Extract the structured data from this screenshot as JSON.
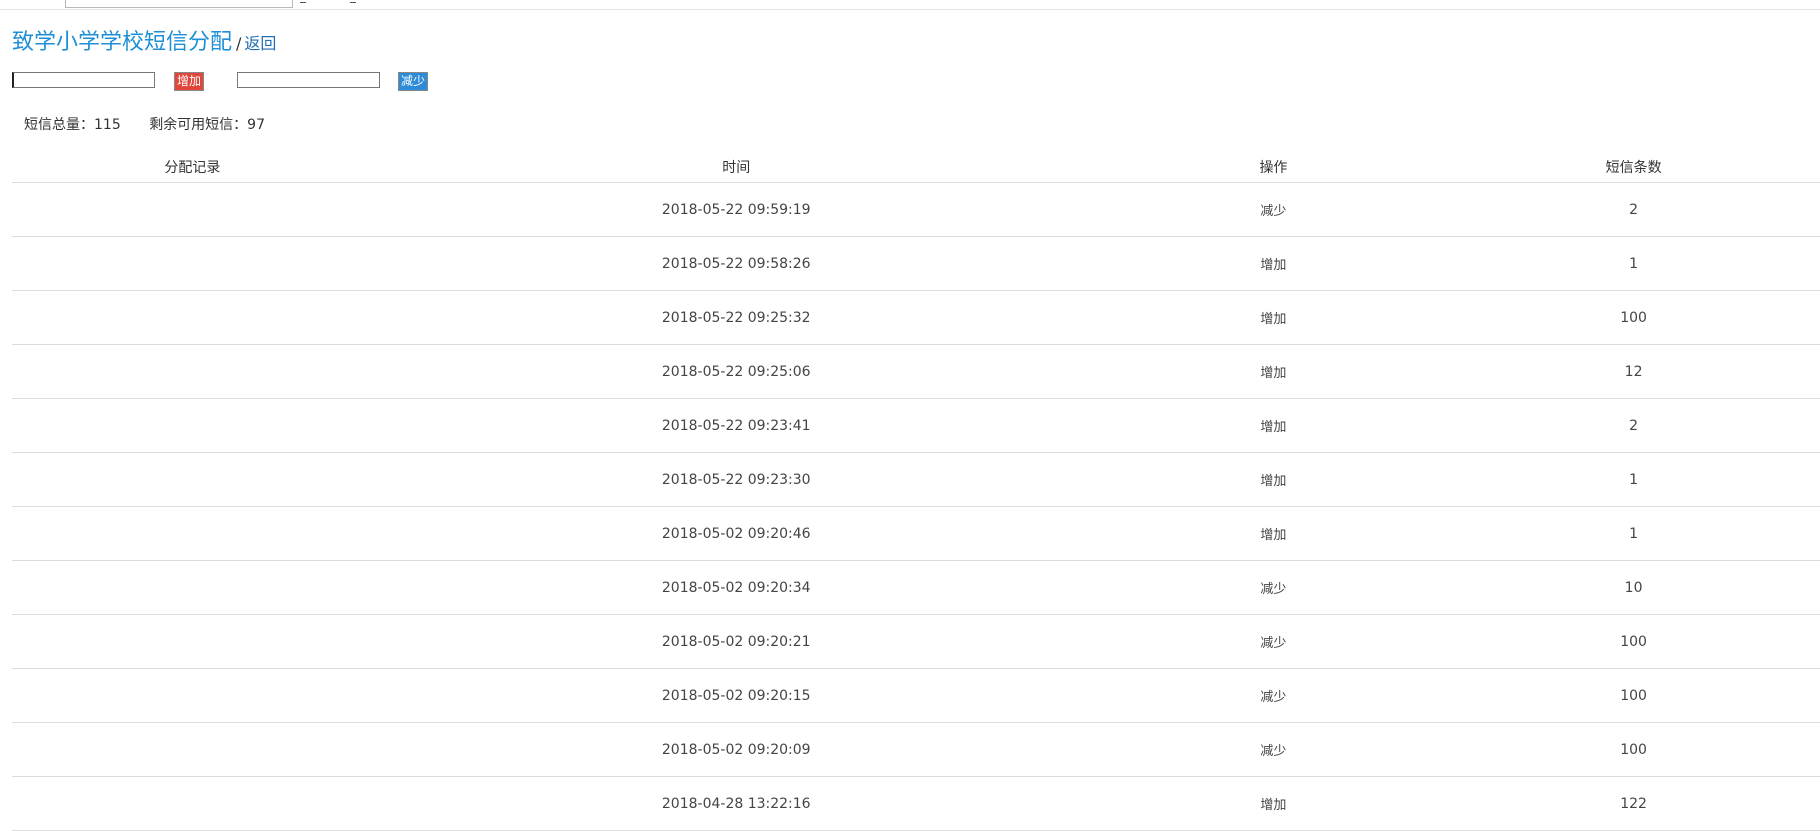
{
  "header": {
    "title": "致学小学学校短信分配",
    "separator": "/",
    "back_label": "返回"
  },
  "controls": {
    "add_label": "增加",
    "sub_label": "减少",
    "add_value": "",
    "sub_value": ""
  },
  "stats": {
    "total_label": "短信总量：115",
    "remaining_label": "剩余可用短信：97"
  },
  "colors": {
    "title": "#1d8fd6",
    "add_button": "#e0463a",
    "sub_button": "#2d8bd8"
  },
  "table": {
    "headers": [
      "分配记录",
      "时间",
      "操作",
      "短信条数"
    ],
    "rows": [
      {
        "record": "",
        "time": "2018-05-22 09:59:19",
        "op": "减少",
        "count": "2"
      },
      {
        "record": "",
        "time": "2018-05-22 09:58:26",
        "op": "增加",
        "count": "1"
      },
      {
        "record": "",
        "time": "2018-05-22 09:25:32",
        "op": "增加",
        "count": "100"
      },
      {
        "record": "",
        "time": "2018-05-22 09:25:06",
        "op": "增加",
        "count": "12"
      },
      {
        "record": "",
        "time": "2018-05-22 09:23:41",
        "op": "增加",
        "count": "2"
      },
      {
        "record": "",
        "time": "2018-05-22 09:23:30",
        "op": "增加",
        "count": "1"
      },
      {
        "record": "",
        "time": "2018-05-02 09:20:46",
        "op": "增加",
        "count": "1"
      },
      {
        "record": "",
        "time": "2018-05-02 09:20:34",
        "op": "减少",
        "count": "10"
      },
      {
        "record": "",
        "time": "2018-05-02 09:20:21",
        "op": "减少",
        "count": "100"
      },
      {
        "record": "",
        "time": "2018-05-02 09:20:15",
        "op": "减少",
        "count": "100"
      },
      {
        "record": "",
        "time": "2018-05-02 09:20:09",
        "op": "减少",
        "count": "100"
      },
      {
        "record": "",
        "time": "2018-04-28 13:22:16",
        "op": "增加",
        "count": "122"
      }
    ]
  }
}
